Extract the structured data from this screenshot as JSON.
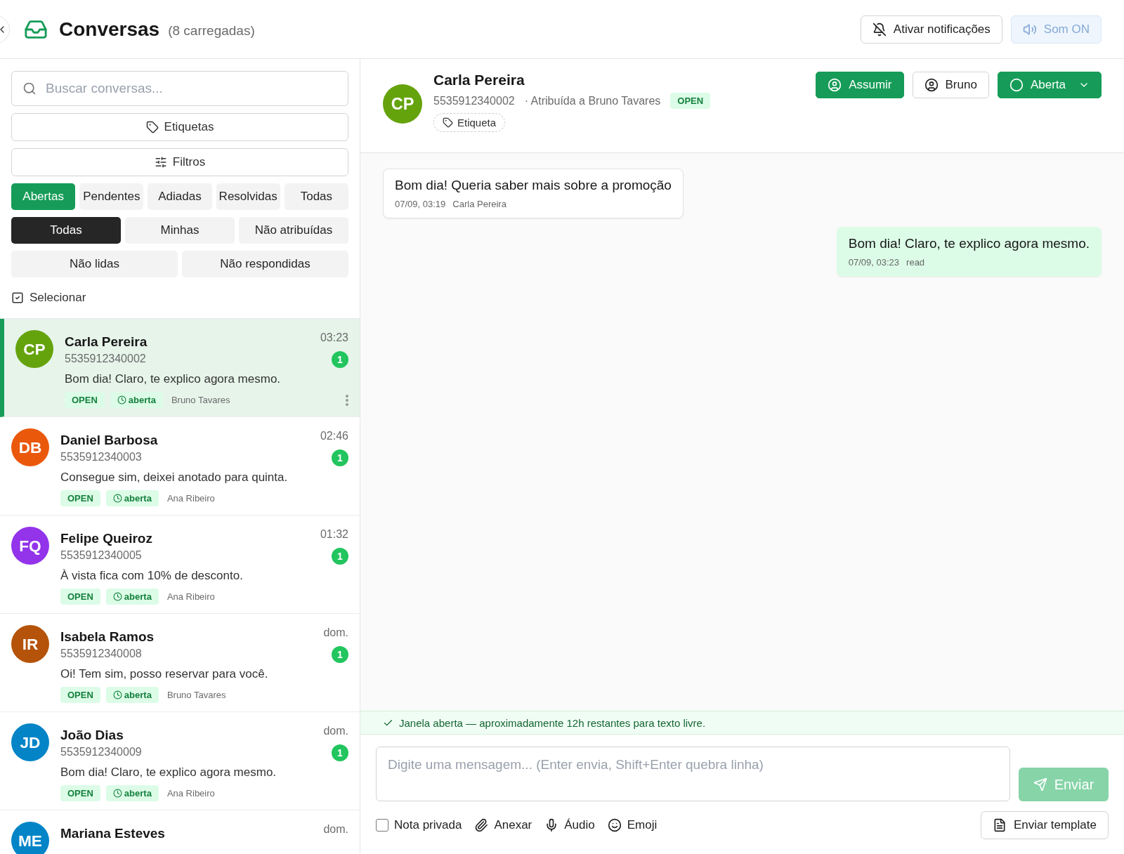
{
  "header": {
    "title": "Conversas",
    "count": "(8 carregadas)",
    "buttons": [
      {
        "kind": "notify",
        "label": "Ativar notificações"
      },
      {
        "kind": "sound",
        "label": "Som ON"
      }
    ]
  },
  "sidebar": {
    "search": {
      "placeholder": "Buscar conversas..."
    },
    "tags_button": "Etiquetas",
    "filters_button": "Filtros",
    "status_tabs": [
      {
        "label": "Abertas",
        "selected": true
      },
      {
        "label": "Pendentes",
        "selected": false
      },
      {
        "label": "Adiadas",
        "selected": false
      },
      {
        "label": "Resolvidas",
        "selected": false
      },
      {
        "label": "Todas",
        "selected": false
      }
    ],
    "assign_tabs": [
      {
        "label": "Todas",
        "selected": true
      },
      {
        "label": "Minhas",
        "selected": false
      },
      {
        "label": "Não atribuídas",
        "selected": false
      }
    ],
    "extra_filters": [
      {
        "label": "Não lidas",
        "selected": false
      },
      {
        "label": "Não respondidas",
        "selected": false
      }
    ],
    "select_label": "Selecionar"
  },
  "conversations": [
    {
      "initials": "CP",
      "color": "#65a30d",
      "name": "Carla Pereira",
      "phone": "5535912340002",
      "time": "03:23",
      "unread": "1",
      "preview": "Bom dia! Claro, te explico agora mesmo.",
      "status": "OPEN",
      "state": "aberta",
      "agent": "Bruno Tavares",
      "selected": true
    },
    {
      "initials": "DB",
      "color": "#ea580c",
      "name": "Daniel Barbosa",
      "phone": "5535912340003",
      "time": "02:46",
      "unread": "1",
      "preview": "Consegue sim, deixei anotado para quinta.",
      "status": "OPEN",
      "state": "aberta",
      "agent": "Ana Ribeiro",
      "selected": false
    },
    {
      "initials": "FQ",
      "color": "#9333ea",
      "name": "Felipe Queiroz",
      "phone": "5535912340005",
      "time": "01:32",
      "unread": "1",
      "preview": "À vista fica com 10% de desconto.",
      "status": "OPEN",
      "state": "aberta",
      "agent": "Ana Ribeiro",
      "selected": false
    },
    {
      "initials": "IR",
      "color": "#b45309",
      "name": "Isabela Ramos",
      "phone": "5535912340008",
      "time": "dom.",
      "unread": "1",
      "preview": "Oi! Tem sim, posso reservar para você.",
      "status": "OPEN",
      "state": "aberta",
      "agent": "Bruno Tavares",
      "selected": false
    },
    {
      "initials": "JD",
      "color": "#0284c7",
      "name": "João Dias",
      "phone": "5535912340009",
      "time": "dom.",
      "unread": "1",
      "preview": "Bom dia! Claro, te explico agora mesmo.",
      "status": "OPEN",
      "state": "aberta",
      "agent": "Ana Ribeiro",
      "selected": false
    },
    {
      "initials": "ME",
      "color": "#0284c7",
      "name": "Mariana Esteves",
      "time": "dom.",
      "selected": false
    }
  ],
  "chat": {
    "initials": "CP",
    "color": "#65a30d",
    "name": "Carla Pereira",
    "phone": "5535912340002",
    "assigned": "· Atribuída a Bruno Tavares",
    "status": "OPEN",
    "tag": "Etiqueta",
    "actions": [
      {
        "kind": "assume",
        "label": "Assumir"
      },
      {
        "kind": "agent",
        "label": "Bruno"
      },
      {
        "kind": "status",
        "label": "Aberta"
      }
    ],
    "messages": [
      {
        "kind": "incoming",
        "text": "Bom dia! Queria saber mais sobre a promoção",
        "time": "07/09, 03:19",
        "meta": "Carla Pereira"
      },
      {
        "kind": "outgoing",
        "text": "Bom dia! Claro, te explico agora mesmo.",
        "time": "07/09, 03:23",
        "meta": "read"
      }
    ],
    "banner": "Janela aberta — aproximadamente 12h restantes para texto livre.",
    "composer": {
      "placeholder": "Digite uma mensagem... (Enter envia, Shift+Enter quebra linha)",
      "send": "Enviar",
      "tools": [
        {
          "kind": "checkbox",
          "label": "Nota privada",
          "checked": false
        },
        {
          "kind": "attach",
          "label": "Anexar"
        },
        {
          "kind": "audio",
          "label": "Áudio"
        },
        {
          "kind": "emoji",
          "label": "Emoji"
        }
      ],
      "template": "Enviar template"
    }
  }
}
